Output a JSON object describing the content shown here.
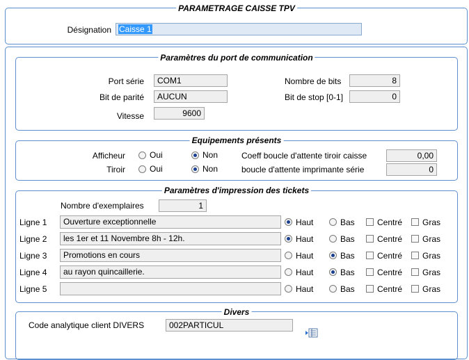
{
  "header": {
    "title": "PARAMETRAGE CAISSE TPV",
    "designation_label": "Désignation",
    "designation_value": "Caisse 1"
  },
  "port": {
    "legend": "Paramètres du port de communication",
    "serial_label": "Port série",
    "serial_value": "COM1",
    "parity_label": "Bit de parité",
    "parity_value": "AUCUN",
    "speed_label": "Vitesse",
    "speed_value": "9600",
    "bits_label": "Nombre de bits",
    "bits_value": "8",
    "stop_label": "Bit de stop [0-1]",
    "stop_value": "0"
  },
  "equipment": {
    "legend": "Equipements présents",
    "display_label": "Afficheur",
    "drawer_label": "Tiroir",
    "oui": "Oui",
    "non": "Non",
    "display_selected": "Non",
    "drawer_selected": "Non",
    "drawer_coeff_label": "Coeff boucle d'attente tiroir caisse",
    "drawer_coeff_value": "0,00",
    "printer_loop_label": "boucle d'attente imprimante série",
    "printer_loop_value": "0"
  },
  "tickets": {
    "legend": "Paramètres d'impression des tickets",
    "copies_label": "Nombre d'exemplaires",
    "copies_value": "1",
    "haut": "Haut",
    "bas": "Bas",
    "centre": "Centré",
    "gras": "Gras",
    "lines": [
      {
        "label": "Ligne 1",
        "text": "Ouverture exceptionnelle",
        "position": "Haut",
        "centered": false,
        "bold": false
      },
      {
        "label": "Ligne 2",
        "text": "les 1er et 11 Novembre 8h - 12h.",
        "position": "Haut",
        "centered": false,
        "bold": false
      },
      {
        "label": "Ligne 3",
        "text": "Promotions en cours",
        "position": "Bas",
        "centered": false,
        "bold": false
      },
      {
        "label": "Ligne 4",
        "text": "au rayon quincaillerie.",
        "position": "Bas",
        "centered": false,
        "bold": false
      },
      {
        "label": "Ligne 5",
        "text": "",
        "position": "",
        "centered": false,
        "bold": false
      }
    ]
  },
  "divers": {
    "legend": "Divers",
    "code_label": "Code analytique client DIVERS",
    "code_value": "002PARTICUL",
    "lookup_icon": "lookup-list-icon"
  }
}
